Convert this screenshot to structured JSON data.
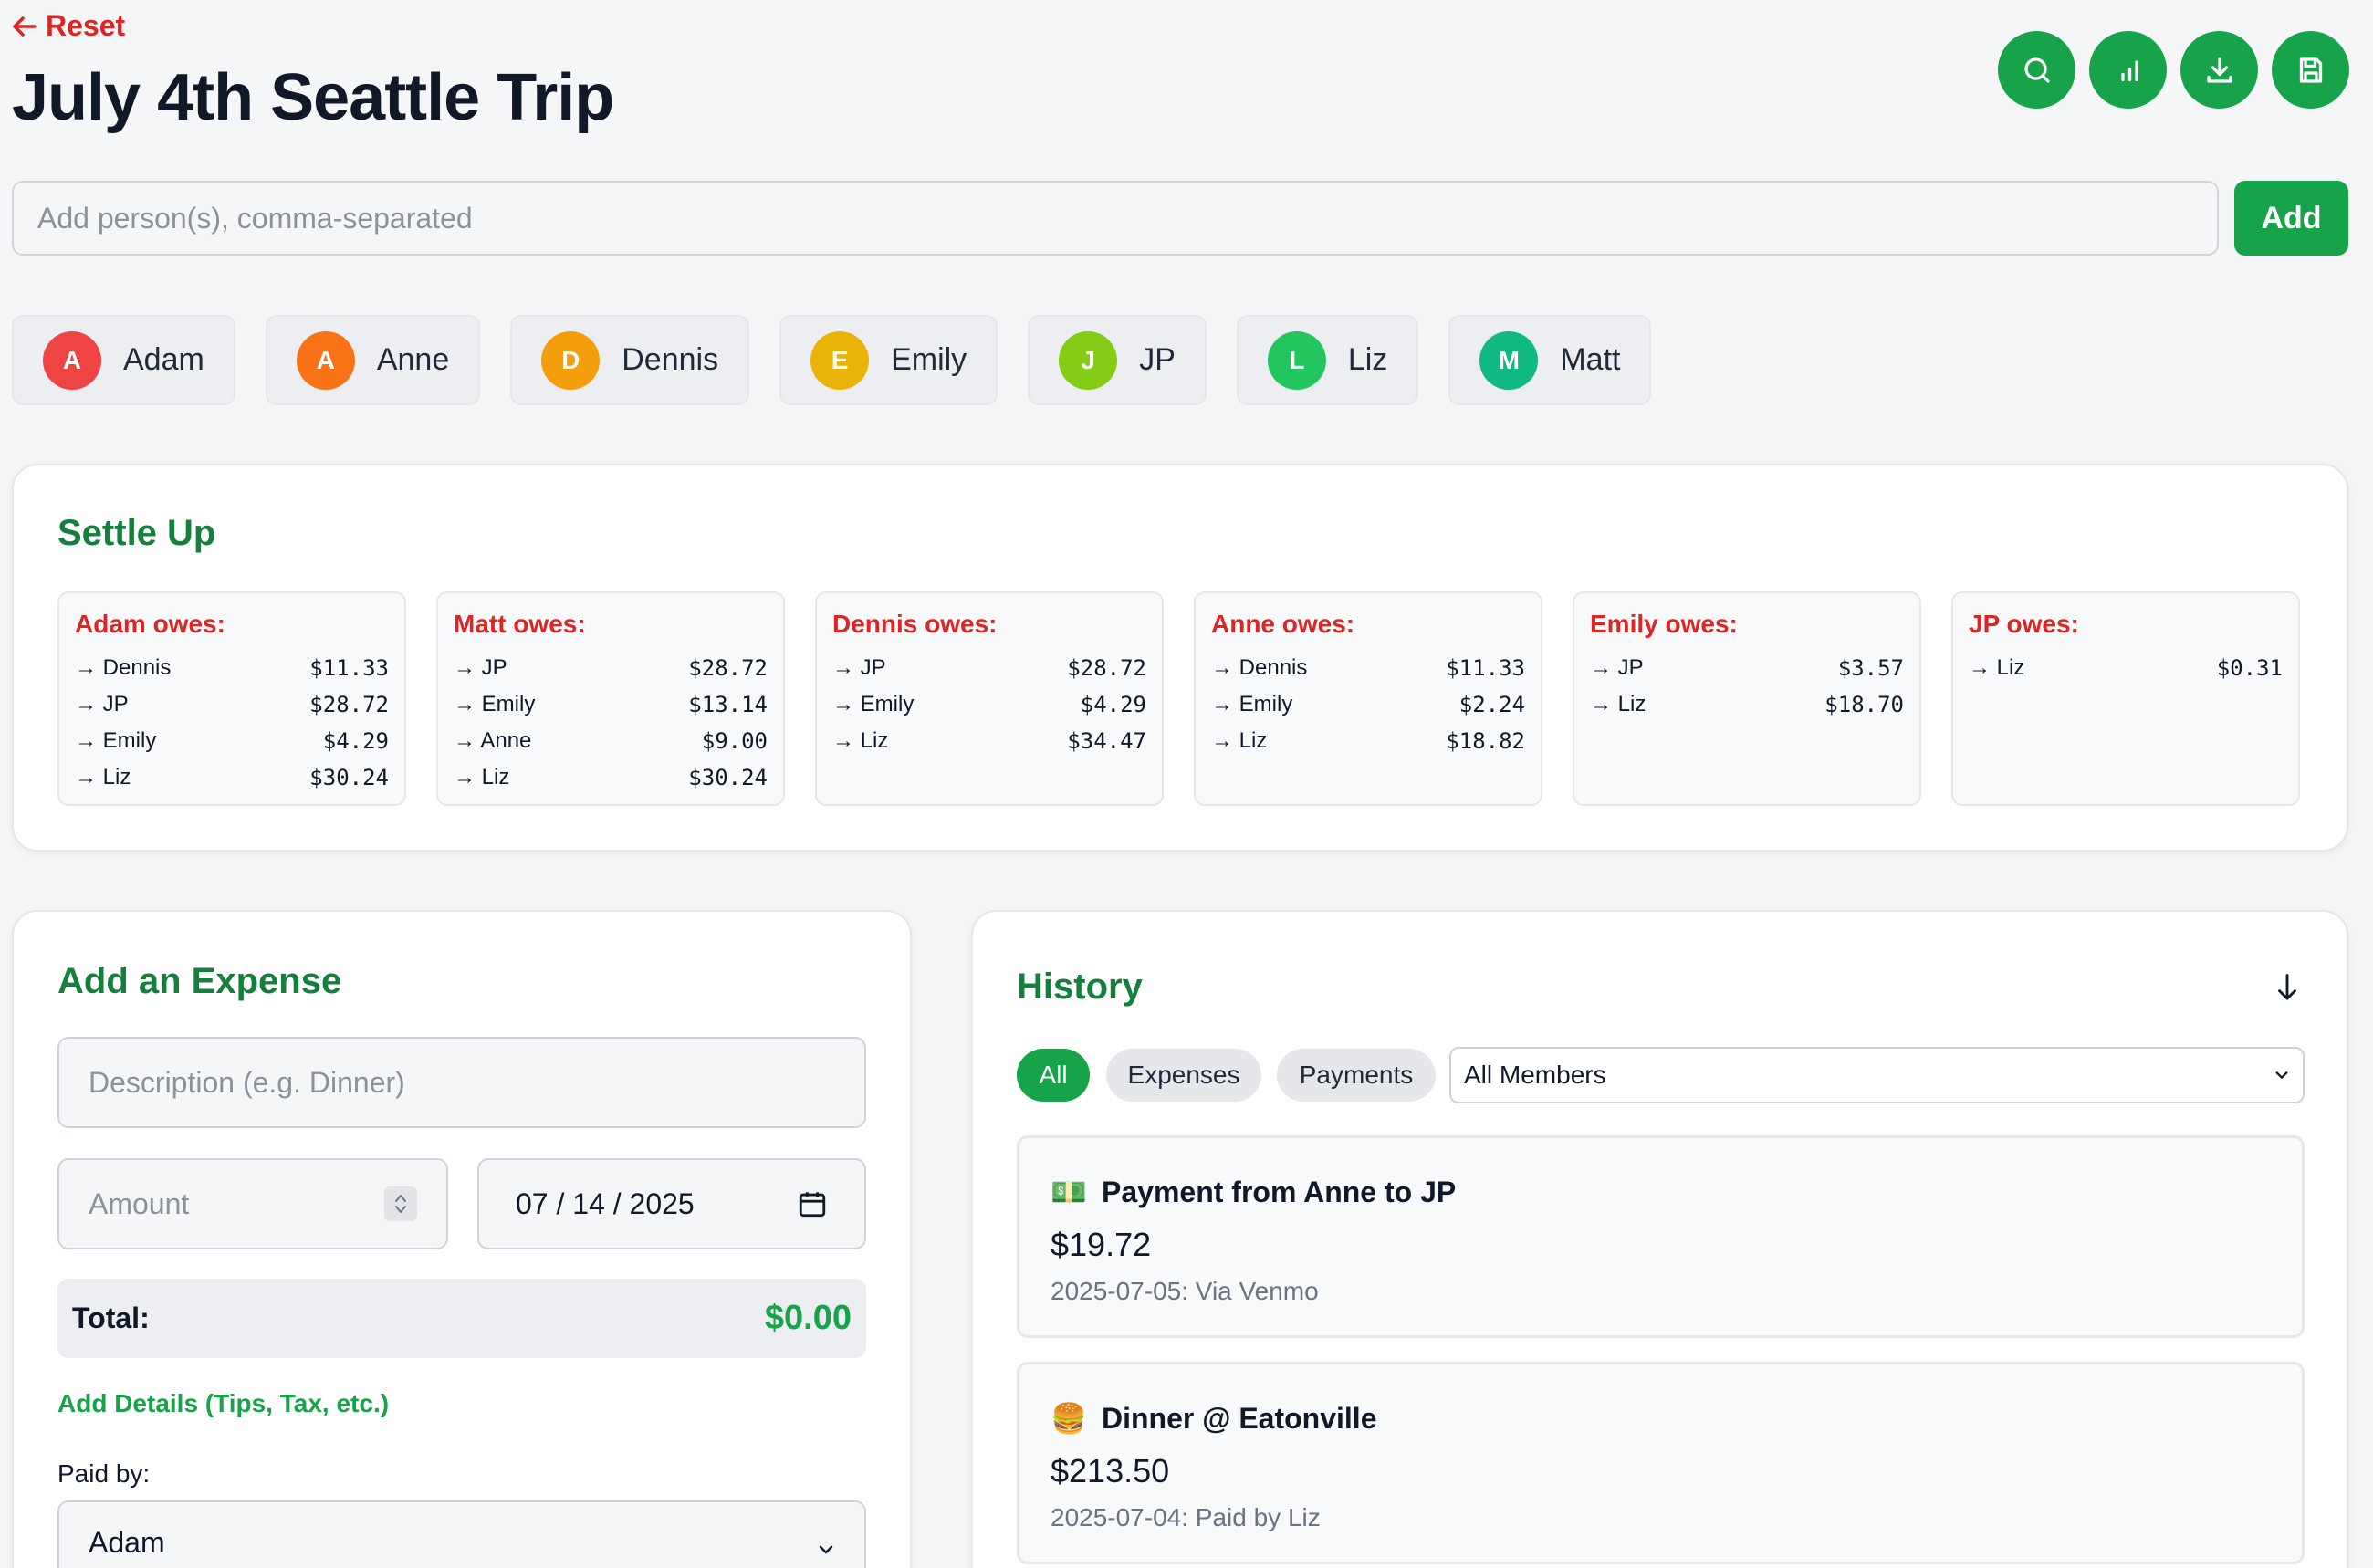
{
  "header": {
    "reset_label": "Reset",
    "title": "July 4th Seattle Trip",
    "toolbar_icons": [
      "search-icon",
      "bar-chart-icon",
      "download-icon",
      "save-icon"
    ]
  },
  "add_person": {
    "placeholder": "Add person(s), comma-separated",
    "button_label": "Add"
  },
  "people": [
    {
      "initial": "A",
      "name": "Adam",
      "color": "#ef4444"
    },
    {
      "initial": "A",
      "name": "Anne",
      "color": "#f97316"
    },
    {
      "initial": "D",
      "name": "Dennis",
      "color": "#f59e0b"
    },
    {
      "initial": "E",
      "name": "Emily",
      "color": "#eab308"
    },
    {
      "initial": "J",
      "name": "JP",
      "color": "#84cc16"
    },
    {
      "initial": "L",
      "name": "Liz",
      "color": "#22c55e"
    },
    {
      "initial": "M",
      "name": "Matt",
      "color": "#10b981"
    }
  ],
  "settle": {
    "title": "Settle Up",
    "groups": [
      {
        "heading": "Adam owes:",
        "rows": [
          {
            "to": "→ Dennis",
            "amount": "$11.33"
          },
          {
            "to": "→ JP",
            "amount": "$28.72"
          },
          {
            "to": "→ Emily",
            "amount": "$4.29"
          },
          {
            "to": "→ Liz",
            "amount": "$30.24"
          }
        ]
      },
      {
        "heading": "Matt owes:",
        "rows": [
          {
            "to": "→ JP",
            "amount": "$28.72"
          },
          {
            "to": "→ Emily",
            "amount": "$13.14"
          },
          {
            "to": "→ Anne",
            "amount": "$9.00"
          },
          {
            "to": "→ Liz",
            "amount": "$30.24"
          }
        ]
      },
      {
        "heading": "Dennis owes:",
        "rows": [
          {
            "to": "→ JP",
            "amount": "$28.72"
          },
          {
            "to": "→ Emily",
            "amount": "$4.29"
          },
          {
            "to": "→ Liz",
            "amount": "$34.47"
          }
        ]
      },
      {
        "heading": "Anne owes:",
        "rows": [
          {
            "to": "→ Dennis",
            "amount": "$11.33"
          },
          {
            "to": "→ Emily",
            "amount": "$2.24"
          },
          {
            "to": "→ Liz",
            "amount": "$18.82"
          }
        ]
      },
      {
        "heading": "Emily owes:",
        "rows": [
          {
            "to": "→ JP",
            "amount": "$3.57"
          },
          {
            "to": "→ Liz",
            "amount": "$18.70"
          }
        ]
      },
      {
        "heading": "JP owes:",
        "rows": [
          {
            "to": "→ Liz",
            "amount": "$0.31"
          }
        ]
      }
    ]
  },
  "expense": {
    "title": "Add an Expense",
    "description_placeholder": "Description (e.g. Dinner)",
    "amount_placeholder": "Amount",
    "date_value": "07 / 14 / 2025",
    "total_label": "Total:",
    "total_value": "$0.00",
    "details_link": "Add Details (Tips, Tax, etc.)",
    "paid_by_label": "Paid by:",
    "paid_by_value": "Adam"
  },
  "history": {
    "title": "History",
    "filters": [
      {
        "label": "All",
        "active": true
      },
      {
        "label": "Expenses",
        "active": false
      },
      {
        "label": "Payments",
        "active": false
      }
    ],
    "member_filter": "All Members",
    "items": [
      {
        "emoji": "💵",
        "title": "Payment from Anne to JP",
        "amount": "$19.72",
        "meta": "2025-07-05: Via Venmo"
      },
      {
        "emoji": "🍔",
        "title": "Dinner @ Eatonville",
        "amount": "$213.50",
        "meta": "2025-07-04: Paid by Liz"
      }
    ]
  },
  "colors": {
    "accent": "#16a34a",
    "accent_dark": "#15803d",
    "danger": "#dc2626"
  }
}
